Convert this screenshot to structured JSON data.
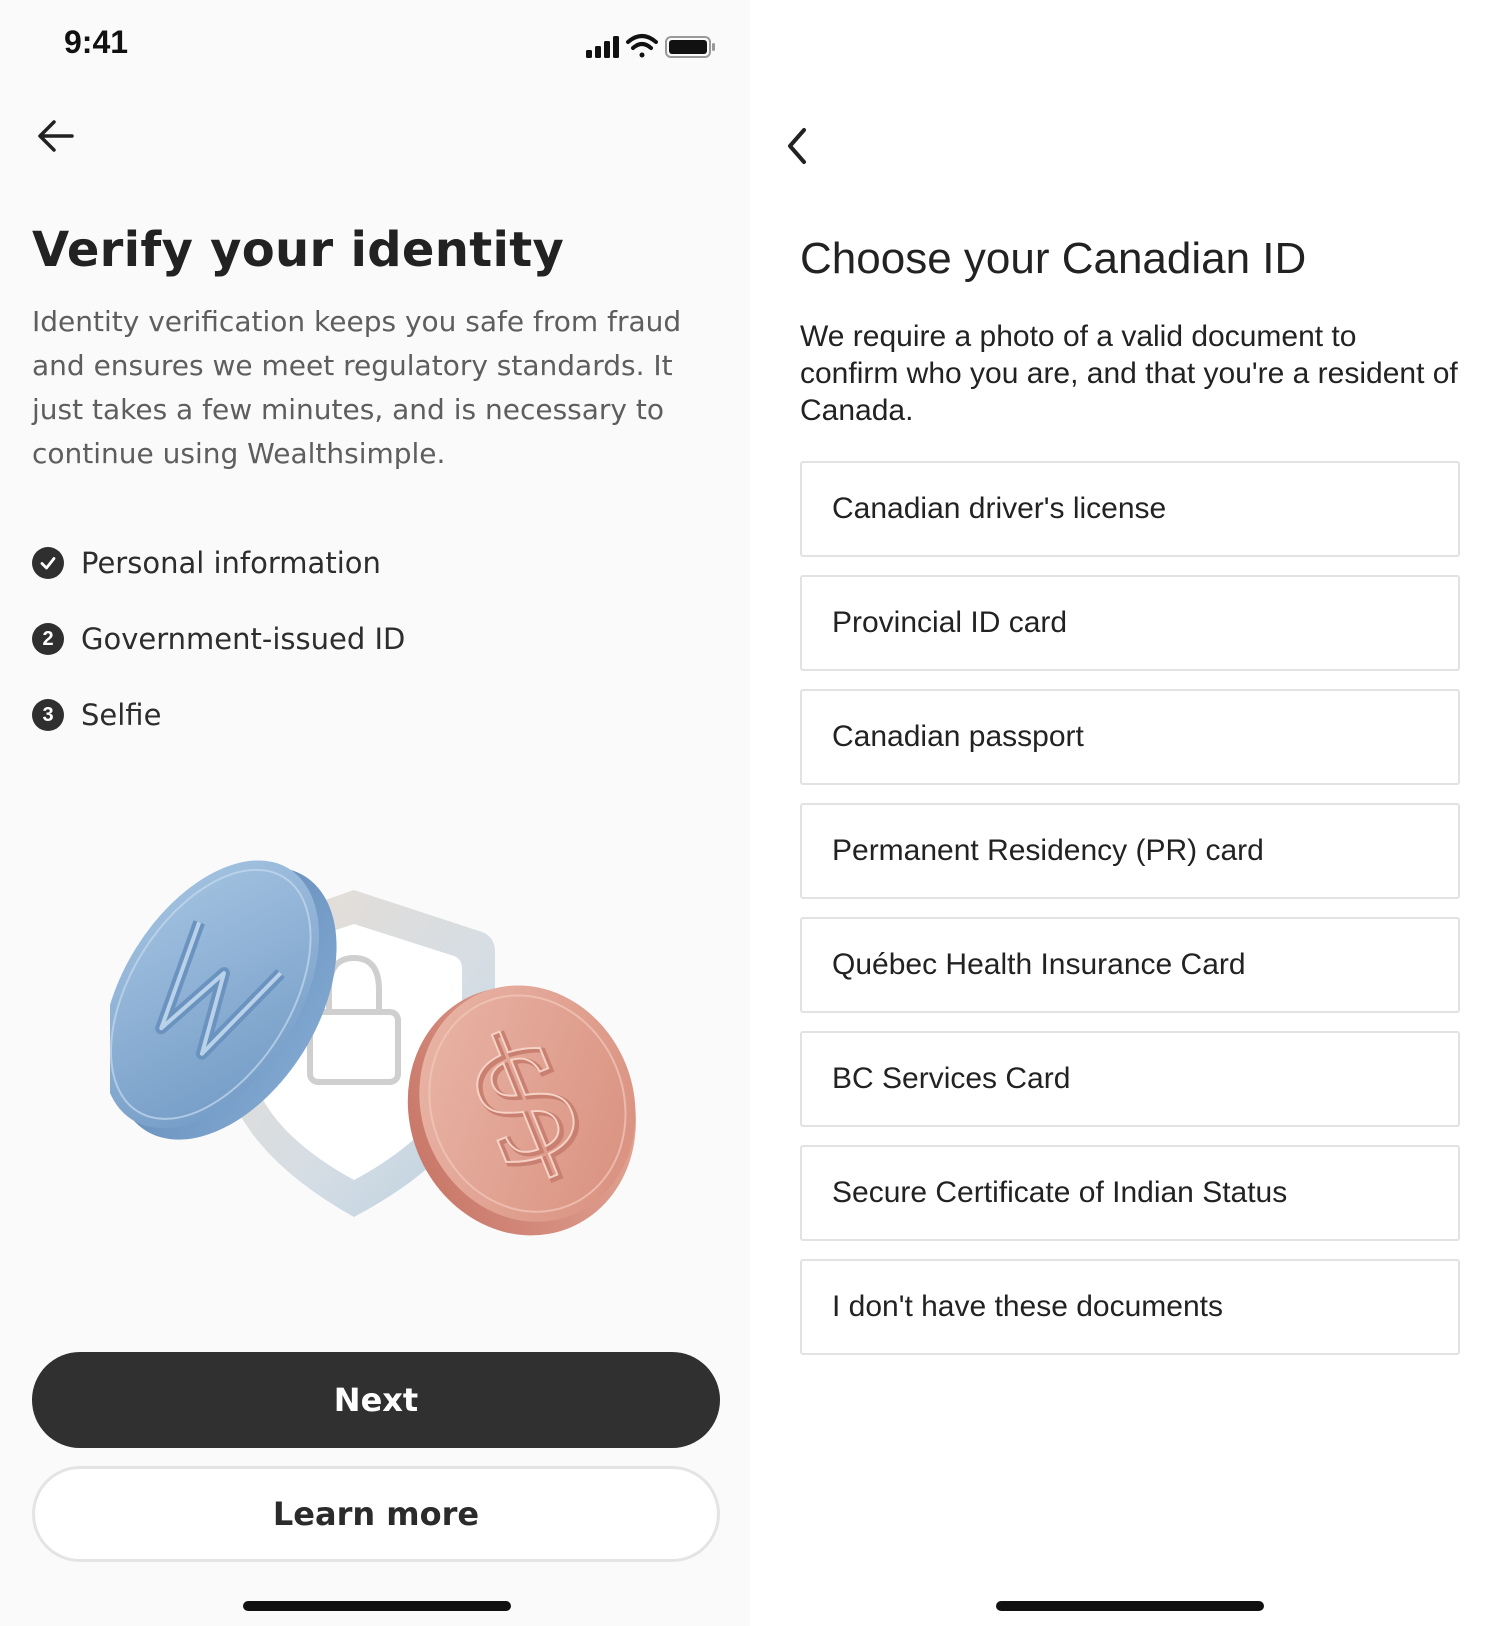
{
  "status_bar": {
    "time": "9:41"
  },
  "verify_screen": {
    "title": "Verify your identity",
    "description": "Identity verification keeps you safe from fraud and ensures we meet regulatory standards. It just takes a few minutes, and is necessary to continue using Wealthsimple.",
    "steps": [
      {
        "badge": "✓",
        "label": "Personal information",
        "status": "completed"
      },
      {
        "badge": "2",
        "label": "Government-issued ID",
        "status": "pending"
      },
      {
        "badge": "3",
        "label": "Selfie",
        "status": "pending"
      }
    ],
    "next_label": "Next",
    "learn_more_label": "Learn more"
  },
  "id_screen": {
    "title": "Choose your Canadian ID",
    "description": "We require a photo of a valid document to confirm who you are, and that you're a resident of Canada.",
    "options": [
      "Canadian driver's license",
      "Provincial ID card",
      "Canadian passport",
      "Permanent Residency (PR) card",
      "Québec Health Insurance Card",
      "BC Services Card",
      "Secure Certificate of Indian Status",
      "I don't have these documents"
    ]
  },
  "icons": {
    "back": "arrow-left-icon",
    "back_chevron": "chevron-left-icon",
    "signal": "cellular-signal-icon",
    "wifi": "wifi-icon",
    "battery": "battery-icon",
    "lock": "lock-icon",
    "coin_w": "wealthsimple-coin-icon",
    "coin_dollar": "dollar-coin-icon"
  },
  "colors": {
    "primary_button": "#303030",
    "text": "#222222",
    "muted_text": "#5e5e5e",
    "border": "#e2e2e2",
    "blue_coin": "#8cb2d8",
    "copper_coin": "#e2a191"
  }
}
